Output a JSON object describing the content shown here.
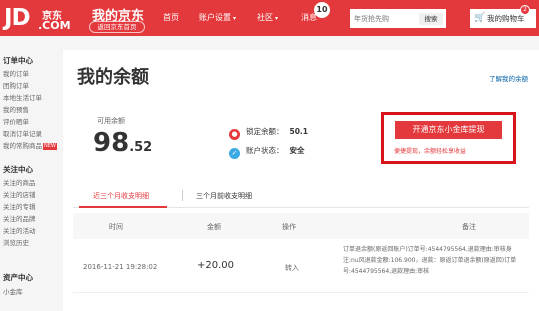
{
  "header": {
    "logo": {
      "mark": "JD",
      "cn": "京东",
      "domain": ".COM"
    },
    "title": "我的京东",
    "back_home": "返回京东首页",
    "nav": {
      "home": "首页",
      "account": "账户设置",
      "community": "社区",
      "messages": "消息",
      "message_count": "10"
    },
    "search": {
      "placeholder": "年货抢先购",
      "button": "搜索"
    },
    "cart": {
      "label": "我的购物车",
      "count": "2"
    }
  },
  "sidebar": {
    "sections": [
      {
        "title": "订单中心",
        "items": [
          "我的订单",
          "团购订单",
          "本地生活订单",
          "我的预售",
          "评价晒单",
          "取消订单记录",
          "我的常购商品"
        ]
      },
      {
        "title": "关注中心",
        "items": [
          "关注的商品",
          "关注的店铺",
          "关注的专辑",
          "关注的品牌",
          "关注的活动",
          "浏览历史"
        ]
      },
      {
        "title": "资产中心",
        "items": [
          "小金库"
        ]
      }
    ],
    "new_badge": "NEW"
  },
  "main": {
    "title": "我的余额",
    "explain_link": "了解我的余额",
    "balance": {
      "label": "可用余额",
      "integer": "98",
      "decimal": ".52"
    },
    "status": {
      "locked_label": "锁定余额：",
      "locked_value": "50.1",
      "state_label": "账户状态：",
      "state_value": "安全"
    },
    "promo": {
      "button": "开通京东小金库提现",
      "subtitle": "便捷提现，余额轻松享收益"
    },
    "tabs": [
      "近三个月收支明细",
      "三个月前收支明细"
    ],
    "table": {
      "headers": [
        "时间",
        "金额",
        "操作",
        "备注"
      ],
      "rows": [
        {
          "time": "2016-11-21 19:28:02",
          "amount": "+20.00",
          "action": "转入",
          "remark": "订单退余额(原返回账户)订单号:4544795564,退款理由:审核身注:nu风退款金额:106.900，退款：原返订单退余额(原返回)订单号:4544795564,退款理由:审核"
        }
      ]
    }
  },
  "colors": {
    "brand_red": "#e4393c",
    "link_blue": "#005ea7",
    "highlight_box": "#d7141a"
  }
}
